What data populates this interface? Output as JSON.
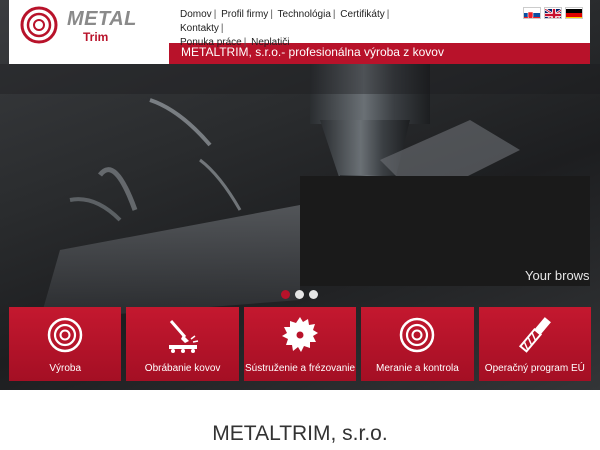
{
  "brand": {
    "logo_metal": "METAL",
    "logo_trim": "Trim",
    "accent": "#b8122a"
  },
  "nav": {
    "items": [
      {
        "label": "Domov"
      },
      {
        "label": "Profil firmy"
      },
      {
        "label": "Technológia"
      },
      {
        "label": "Certifikáty"
      },
      {
        "label": "Kontakty"
      },
      {
        "label": "Ponuka práce"
      },
      {
        "label": "Neplatiči"
      }
    ]
  },
  "languages": [
    {
      "name": "slovak-flag-icon"
    },
    {
      "name": "english-flag-icon"
    },
    {
      "name": "german-flag-icon"
    }
  ],
  "header": {
    "tagline": "METALTRIM, s.r.o.- profesionálna výroba z kovov"
  },
  "hero": {
    "video_message": "Your brows",
    "slides": 3,
    "active_slide": 1
  },
  "tiles": [
    {
      "label": "Výroba",
      "icon": "rings-logo-icon"
    },
    {
      "label": "Obrábanie kovov",
      "icon": "machining-icon"
    },
    {
      "label": "Sústruženie a frézovanie",
      "icon": "saw-blade-icon"
    },
    {
      "label": "Meranie a kontrola",
      "icon": "measure-rings-icon"
    },
    {
      "label": "Operačný program EÚ",
      "icon": "end-mill-icon"
    }
  ],
  "main": {
    "company_title": "METALTRIM, s.r.o."
  }
}
